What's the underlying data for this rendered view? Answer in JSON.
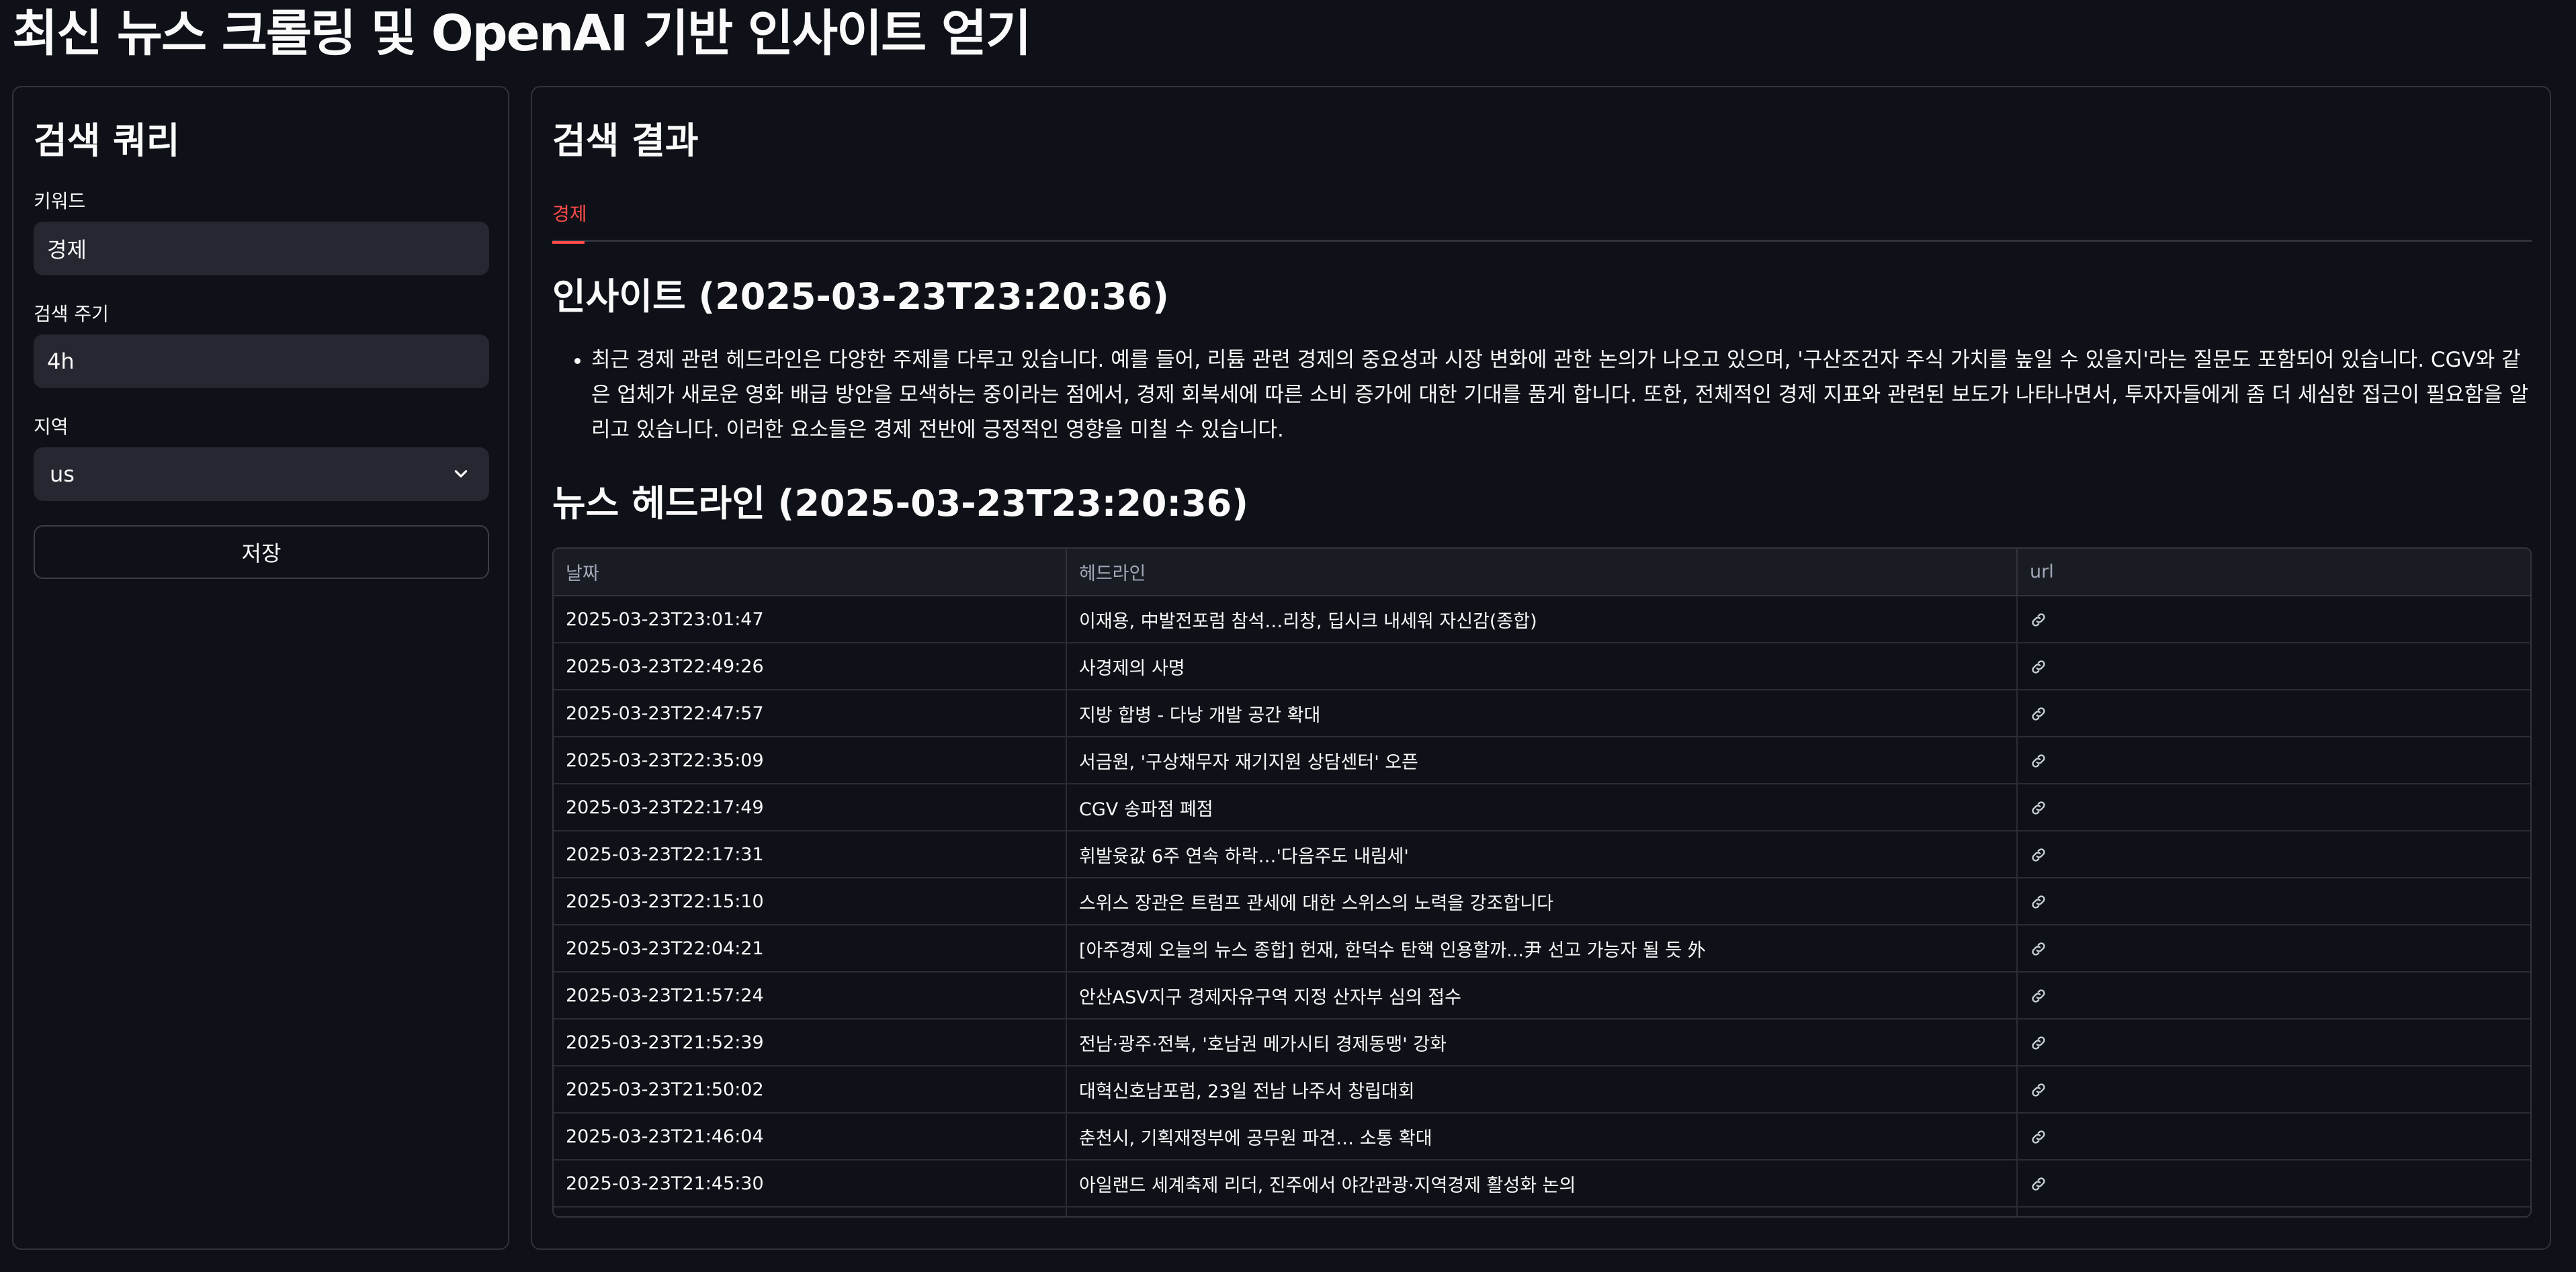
{
  "app": {
    "title": "최신 뉴스 크롤링 및 OpenAI 기반 인사이트 얻기"
  },
  "sidebar": {
    "heading": "검색 쿼리",
    "keyword": {
      "label": "키워드",
      "value": "경제"
    },
    "interval": {
      "label": "검색 주기",
      "value": "4h"
    },
    "region": {
      "label": "지역",
      "value": "us"
    },
    "save_label": "저장"
  },
  "main": {
    "heading": "검색 결과",
    "tabs": [
      {
        "label": "경제",
        "active": true
      }
    ],
    "insight_heading": "인사이트 (2025-03-23T23:20:36)",
    "insight_text": "최근 경제 관련 헤드라인은 다양한 주제를 다루고 있습니다. 예를 들어, 리튬 관련 경제의 중요성과 시장 변화에 관한 논의가 나오고 있으며, '구산조건자 주식 가치를 높일 수 있을지'라는 질문도 포함되어 있습니다. CGV와 같은 업체가 새로운 영화 배급 방안을 모색하는 중이라는 점에서, 경제 회복세에 따른 소비 증가에 대한 기대를 품게 합니다. 또한, 전체적인 경제 지표와 관련된 보도가 나타나면서, 투자자들에게 좀 더 세심한 접근이 필요함을 알리고 있습니다. 이러한 요소들은 경제 전반에 긍정적인 영향을 미칠 수 있습니다.",
    "headlines_heading": "뉴스 헤드라인 (2025-03-23T23:20:36)",
    "table": {
      "columns": [
        "날짜",
        "헤드라인",
        "url"
      ],
      "link_icon": "link-icon",
      "rows": [
        {
          "date": "2025-03-23T23:01:47",
          "headline": "이재용, 中발전포럼 참석…리창, 딥시크 내세워 자신감(종합)"
        },
        {
          "date": "2025-03-23T22:49:26",
          "headline": "사경제의 사명"
        },
        {
          "date": "2025-03-23T22:47:57",
          "headline": "지방 합병 - 다낭 개발 공간 확대"
        },
        {
          "date": "2025-03-23T22:35:09",
          "headline": "서금원, '구상채무자 재기지원 상담센터' 오픈"
        },
        {
          "date": "2025-03-23T22:17:49",
          "headline": "CGV 송파점 폐점"
        },
        {
          "date": "2025-03-23T22:17:31",
          "headline": "휘발윳값 6주 연속 하락…'다음주도 내림세'"
        },
        {
          "date": "2025-03-23T22:15:10",
          "headline": "스위스 장관은 트럼프 관세에 대한 스위스의 노력을 강조합니다"
        },
        {
          "date": "2025-03-23T22:04:21",
          "headline": "[아주경제 오늘의 뉴스 종합] 헌재, 한덕수 탄핵 인용할까...尹 선고 가능자 될 듯 外"
        },
        {
          "date": "2025-03-23T21:57:24",
          "headline": "안산ASV지구 경제자유구역 지정 산자부 심의 접수"
        },
        {
          "date": "2025-03-23T21:52:39",
          "headline": "전남·광주·전북, '호남권 메가시티 경제동맹' 강화"
        },
        {
          "date": "2025-03-23T21:50:02",
          "headline": "대혁신호남포럼, 23일 전남 나주서 창립대회"
        },
        {
          "date": "2025-03-23T21:46:04",
          "headline": "춘천시, 기획재정부에 공무원 파견… 소통 확대"
        },
        {
          "date": "2025-03-23T21:45:30",
          "headline": "아일랜드 세계축제 리더, 진주에서 야간관광·지역경제 활성화 논의"
        },
        {
          "date": "",
          "headline": ""
        }
      ]
    }
  },
  "colors": {
    "background": "#0e1117",
    "accent": "#ff4b4b",
    "input_bg": "#262730",
    "border": "#31333f"
  }
}
